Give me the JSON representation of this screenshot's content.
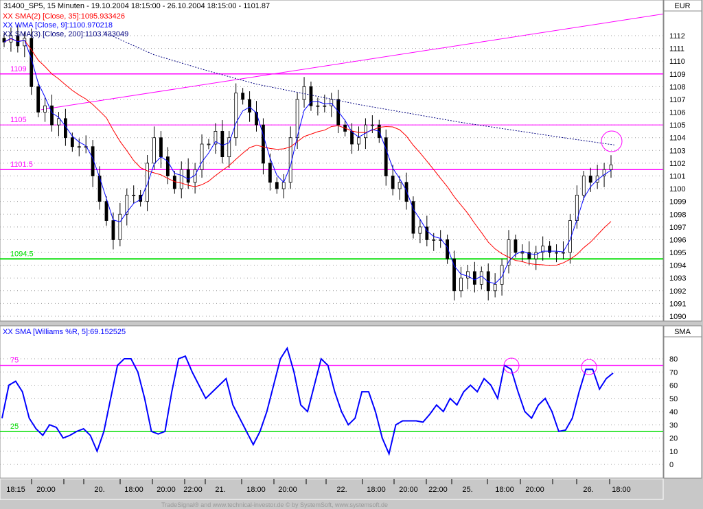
{
  "header": {
    "title": "31400_SP5, 15 Minuten - 19.10.2004 18:15:00 - 26.10.2004 18:15:00 - 1101.87",
    "legend": [
      {
        "text": "XX SMA(2) [Close, 35]:1095.933426",
        "color": "#ff0000"
      },
      {
        "text": "XX WMA [Close, 9]:1100.970218",
        "color": "#0000ff"
      },
      {
        "text": "XX SMA(3) [Close, 200]:1103.433049",
        "color": "#000080"
      }
    ],
    "currency": "EUR"
  },
  "lower": {
    "legend": "XX SMA [Williams %R, 5]:69.152525",
    "axis_label": "SMA"
  },
  "footer": "TradeSignal® and www.technical-investor.de © by SystemSoft, www.systemsoft.de",
  "chart_data": [
    {
      "type": "candlestick",
      "title": "31400_SP5, 15 Minuten",
      "ylim": [
        1089.7,
        1113.4
      ],
      "yticks": [
        1090,
        1091,
        1092,
        1093,
        1094,
        1095,
        1096,
        1097,
        1098,
        1099,
        1100,
        1101,
        1102,
        1103,
        1104,
        1105,
        1106,
        1107,
        1108,
        1109,
        1110,
        1111,
        1112
      ],
      "xticks": [
        "18:15",
        "20:00",
        "20.",
        "18:00",
        "20:00",
        "22:00",
        "21.",
        "18:00",
        "20:00",
        "22.",
        "18:00",
        "20:00",
        "22:00",
        "25.",
        "18:00",
        "20:00",
        "26.",
        "18:00"
      ],
      "close": [
        1111.5,
        1112,
        1111.2,
        1111.8,
        1108,
        1106,
        1106.5,
        1105,
        1105.5,
        1104,
        1103.3,
        1103.3,
        1103.3,
        1101,
        1099,
        1097.5,
        1096,
        1098,
        1099.5,
        1099.5,
        1099,
        1102,
        1104,
        1102.5,
        1101,
        1100,
        1101.5,
        1100.5,
        1101.5,
        1103.5,
        1103.5,
        1104.5,
        1102.5,
        1104,
        1107.5,
        1107,
        1106,
        1105,
        1102,
        1100.5,
        1100,
        1100.5,
        1104,
        1107,
        1108,
        1106.5,
        1106.5,
        1106.5,
        1107,
        1105,
        1104.5,
        1103.5,
        1104,
        1105,
        1105,
        1104,
        1101,
        1100,
        1100.5,
        1099,
        1096.5,
        1097,
        1096,
        1096,
        1096,
        1094.5,
        1092,
        1093,
        1093.5,
        1092.5,
        1093.5,
        1092,
        1092.5,
        1094,
        1096,
        1095,
        1095,
        1094.5,
        1095,
        1095.5,
        1095,
        1095,
        1095,
        1097.5,
        1099.5,
        1101,
        1100.5,
        1101,
        1101.5,
        1101.87
      ],
      "series": [
        {
          "name": "SMA(2) [Close, 35]",
          "color": "#ff0000",
          "last": 1095.933426
        },
        {
          "name": "WMA [Close, 9]",
          "color": "#0000ff",
          "last": 1100.970218
        },
        {
          "name": "SMA(3) [Close, 200]",
          "color": "#000080",
          "style": "dotted",
          "values": [
            1112.3,
            1110.5,
            1109.3,
            1108.2,
            1107.4,
            1106.6,
            1105.9,
            1105.2,
            1104.6,
            1104,
            1103.43
          ]
        }
      ],
      "trendline": {
        "color": "#ff00ff",
        "from": 1106.2,
        "to": 1113.7
      },
      "hlines": [
        {
          "label": "1109",
          "value": 1109,
          "color": "#ff00ff"
        },
        {
          "label": "1105",
          "value": 1105,
          "color": "#ff00ff"
        },
        {
          "label": "1101.5",
          "value": 1101.5,
          "color": "#ff00ff"
        },
        {
          "label": "1094.5",
          "value": 1094.5,
          "color": "#00dd00"
        }
      ]
    },
    {
      "type": "line",
      "title": "SMA [Williams %R, 5]",
      "ylim": [
        -5,
        92
      ],
      "yticks": [
        0,
        10,
        20,
        30,
        40,
        50,
        60,
        70,
        80
      ],
      "values": [
        35,
        60,
        63,
        55,
        35,
        27,
        22,
        30,
        28,
        20,
        22,
        25,
        27,
        22,
        10,
        25,
        50,
        75,
        80,
        80,
        70,
        50,
        25,
        23,
        25,
        55,
        80,
        82,
        70,
        60,
        50,
        55,
        60,
        65,
        45,
        35,
        25,
        15,
        25,
        40,
        60,
        80,
        88,
        70,
        45,
        40,
        60,
        80,
        75,
        55,
        40,
        30,
        35,
        55,
        55,
        40,
        20,
        8,
        30,
        33,
        33,
        33,
        32,
        38,
        45,
        40,
        50,
        45,
        55,
        60,
        55,
        65,
        60,
        50,
        75,
        72,
        55,
        40,
        35,
        45,
        50,
        40,
        25,
        26,
        35,
        55,
        72,
        72,
        57,
        65,
        69.15
      ],
      "color": "#0000ff",
      "hlines": [
        {
          "label": "75",
          "value": 75,
          "color": "#ff00ff"
        },
        {
          "label": "25",
          "value": 25,
          "color": "#00dd00"
        }
      ]
    }
  ]
}
